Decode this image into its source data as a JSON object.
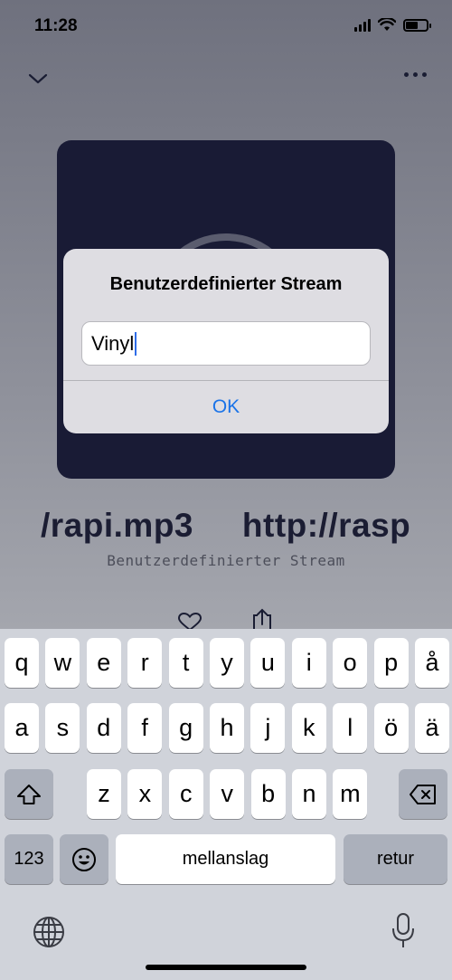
{
  "status": {
    "time": "11:28"
  },
  "nowplaying": {
    "title": "/rapi.mp3     http://rasp",
    "subtitle": "Benutzerdefinierter Stream"
  },
  "alert": {
    "title": "Benutzerdefinierter Stream",
    "input_value": "Vinyl",
    "ok_label": "OK"
  },
  "keyboard": {
    "row1": [
      "q",
      "w",
      "e",
      "r",
      "t",
      "y",
      "u",
      "i",
      "o",
      "p",
      "å"
    ],
    "row2": [
      "a",
      "s",
      "d",
      "f",
      "g",
      "h",
      "j",
      "k",
      "l",
      "ö",
      "ä"
    ],
    "row3": [
      "z",
      "x",
      "c",
      "v",
      "b",
      "n",
      "m"
    ],
    "numbers_label": "123",
    "space_label": "mellanslag",
    "return_label": "retur"
  },
  "colors": {
    "accent": "#1a73e8",
    "artwork_bg": "#191b35",
    "text_dark": "#1b1d33"
  },
  "icons": [
    "chevron-down-icon",
    "more-icon",
    "heart-icon",
    "share-icon",
    "shift-icon",
    "delete-icon",
    "emoji-icon",
    "globe-icon",
    "microphone-icon"
  ]
}
